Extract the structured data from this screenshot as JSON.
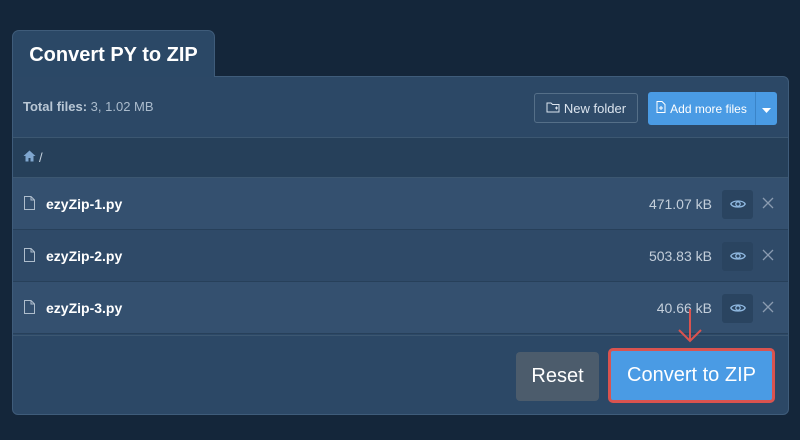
{
  "tab_title": "Convert PY to ZIP",
  "toolbar": {
    "total_label": "Total files:",
    "total_value": "3, 1.02 MB",
    "new_folder_label": "New folder",
    "add_files_label": "Add more files"
  },
  "breadcrumb": {
    "separator": "/"
  },
  "files": [
    {
      "name": "ezyZip-1.py",
      "size": "471.07 kB"
    },
    {
      "name": "ezyZip-2.py",
      "size": "503.83 kB"
    },
    {
      "name": "ezyZip-3.py",
      "size": "40.66 kB"
    }
  ],
  "footer": {
    "reset_label": "Reset",
    "convert_label": "Convert to ZIP"
  },
  "colors": {
    "background": "#14263a",
    "panel": "#2c4866",
    "primary_button": "#4a9be4",
    "highlight_border": "#d9534f",
    "reset_button": "#4c5c6c"
  },
  "icons": [
    "home-icon",
    "folder-plus-icon",
    "file-plus-icon",
    "caret-down-icon",
    "file-icon",
    "eye-icon",
    "close-icon",
    "arrow-down-icon"
  ]
}
